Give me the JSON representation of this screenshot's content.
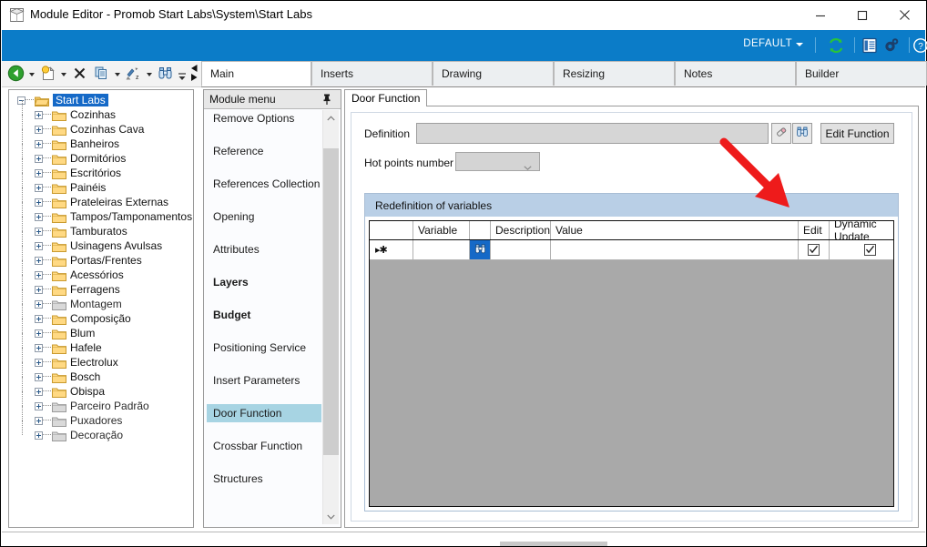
{
  "window": {
    "title": "Module Editor - Promob Start Labs\\System\\Start Labs",
    "icon": "module-window-icon",
    "minimize_label": "—",
    "maximize_label": "☐",
    "close_label": "✕"
  },
  "ribbon": {
    "profile_label": "DEFAULT",
    "icons": [
      "refresh-icon",
      "grid-view-icon",
      "settings-gears-icon",
      "help-icon"
    ]
  },
  "toolbar": {
    "items": [
      {
        "name": "back-icon",
        "label": ""
      },
      {
        "name": "new-item-icon",
        "label": ""
      },
      {
        "name": "delete-icon",
        "label": ""
      },
      {
        "name": "copy-icon",
        "label": ""
      },
      {
        "name": "sort-az-icon",
        "label": ""
      },
      {
        "name": "find-binoculars-icon",
        "label": ""
      }
    ],
    "overflow_label": "»"
  },
  "tabs": [
    {
      "label": "Main",
      "active": true
    },
    {
      "label": "Inserts",
      "active": false
    },
    {
      "label": "Drawing",
      "active": false
    },
    {
      "label": "Resizing",
      "active": false
    },
    {
      "label": "Notes",
      "active": false
    },
    {
      "label": "Builder",
      "active": false
    }
  ],
  "tree": {
    "root": {
      "label": "Start Labs",
      "selected": true,
      "expanded": true
    },
    "children": [
      "Cozinhas",
      "Cozinhas Cava",
      "Banheiros",
      "Dormitórios",
      "Escritórios",
      "Painéis",
      "Prateleiras Externas",
      "Tampos/Tamponamentos",
      "Tamburatos",
      "Usinagens Avulsas",
      "Portas/Frentes",
      "Acessórios",
      "Ferragens",
      "Montagem",
      "Composição",
      "Blum",
      "Hafele",
      "Electrolux",
      "Bosch",
      "Obispa",
      "Parceiro Padrão",
      "Puxadores",
      "Decoração"
    ],
    "greyed": [
      "Montagem",
      "Parceiro Padrão",
      "Puxadores",
      "Decoração"
    ]
  },
  "module_menu": {
    "title": "Module menu",
    "pin_icon": "pin-icon",
    "items": [
      {
        "label": "Remove Options",
        "bold": false,
        "selected": false
      },
      {
        "label": "Reference",
        "bold": false,
        "selected": false
      },
      {
        "label": "References Collection",
        "bold": false,
        "selected": false
      },
      {
        "label": "Opening",
        "bold": false,
        "selected": false
      },
      {
        "label": "Attributes",
        "bold": false,
        "selected": false
      },
      {
        "label": "Layers",
        "bold": true,
        "selected": false
      },
      {
        "label": "Budget",
        "bold": true,
        "selected": false
      },
      {
        "label": "Positioning Service",
        "bold": false,
        "selected": false
      },
      {
        "label": "Insert Parameters",
        "bold": false,
        "selected": false
      },
      {
        "label": "Door Function",
        "bold": false,
        "selected": true
      },
      {
        "label": "Crossbar Function",
        "bold": false,
        "selected": false
      },
      {
        "label": "Structures",
        "bold": false,
        "selected": false
      }
    ]
  },
  "content": {
    "tab_label": "Door Function",
    "definition_label": "Definition",
    "definition_value": "",
    "definition_placeholder": "",
    "erase_icon": "eraser-icon",
    "search_icon": "binoculars-icon",
    "edit_function_label": "Edit Function",
    "hot_points_label": "Hot points number",
    "hot_points_value": "",
    "group_title": "Redefinition of variables",
    "grid": {
      "columns": [
        "",
        "Variable",
        "",
        "Description",
        "Value",
        "Edit",
        "Dynamic Update"
      ],
      "rows": [
        {
          "marker": "▸✱",
          "variable": "",
          "picker_icon": "binoculars-icon",
          "description": "",
          "value": "",
          "edit_checked": true,
          "dynamic_update_checked": true
        }
      ]
    }
  },
  "annotation": {
    "arrow": "red-arrow-annotation",
    "color": "#ee1b1b",
    "points_to": "Edit"
  },
  "colors": {
    "ribbon_blue": "#0b7cc8",
    "selection_blue": "#1569c7",
    "group_header_blue": "#b9cfe6",
    "menu_selection": "#a7d4e3",
    "grid_body_grey": "#a9a9a9",
    "annotation_red": "#ee1b1b"
  }
}
